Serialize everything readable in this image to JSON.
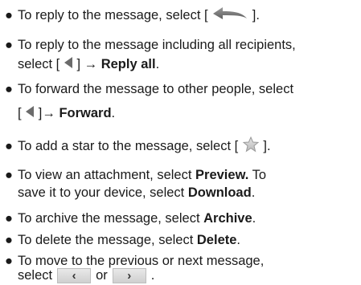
{
  "bullet": "●",
  "items": [
    {
      "lines": [
        {
          "a": "To reply to the message, select [ ",
          "icon": "reply-arrow-icon",
          "b": " ]."
        }
      ]
    },
    {
      "lines": [
        {
          "a": "To reply to the message including all recipients,"
        },
        {
          "a": "select [ ",
          "icon": "menu-arrow-icon",
          "b": " ] → ",
          "bold": "Reply all",
          "c": "."
        }
      ]
    },
    {
      "lines": [
        {
          "a": "To forward the message to other people, select"
        },
        {
          "a": "[ ",
          "icon": "menu-arrow-icon",
          "b": " ]→ ",
          "bold": "Forward",
          "c": "."
        }
      ]
    },
    {
      "lines": [
        {
          "a": "To add a star to the message, select [ ",
          "icon": "star-icon",
          "b": " ]."
        }
      ]
    },
    {
      "lines": [
        {
          "a": "To view an attachment, select ",
          "bold": "Preview.",
          "c": " To"
        },
        {
          "a": "save it to your device, select ",
          "bold": "Download",
          "c": "."
        }
      ]
    },
    {
      "lines": [
        {
          "a": "To archive the message, select ",
          "bold": "Archive",
          "c": "."
        }
      ]
    },
    {
      "lines": [
        {
          "a": "To delete the message, select ",
          "bold": "Delete",
          "c": "."
        }
      ]
    },
    {
      "lines": [
        {
          "a": "To move to the previous or next message,"
        },
        {
          "a": "select",
          "prev": "‹",
          "or": "or",
          "next": "›",
          "c": "."
        }
      ]
    }
  ]
}
